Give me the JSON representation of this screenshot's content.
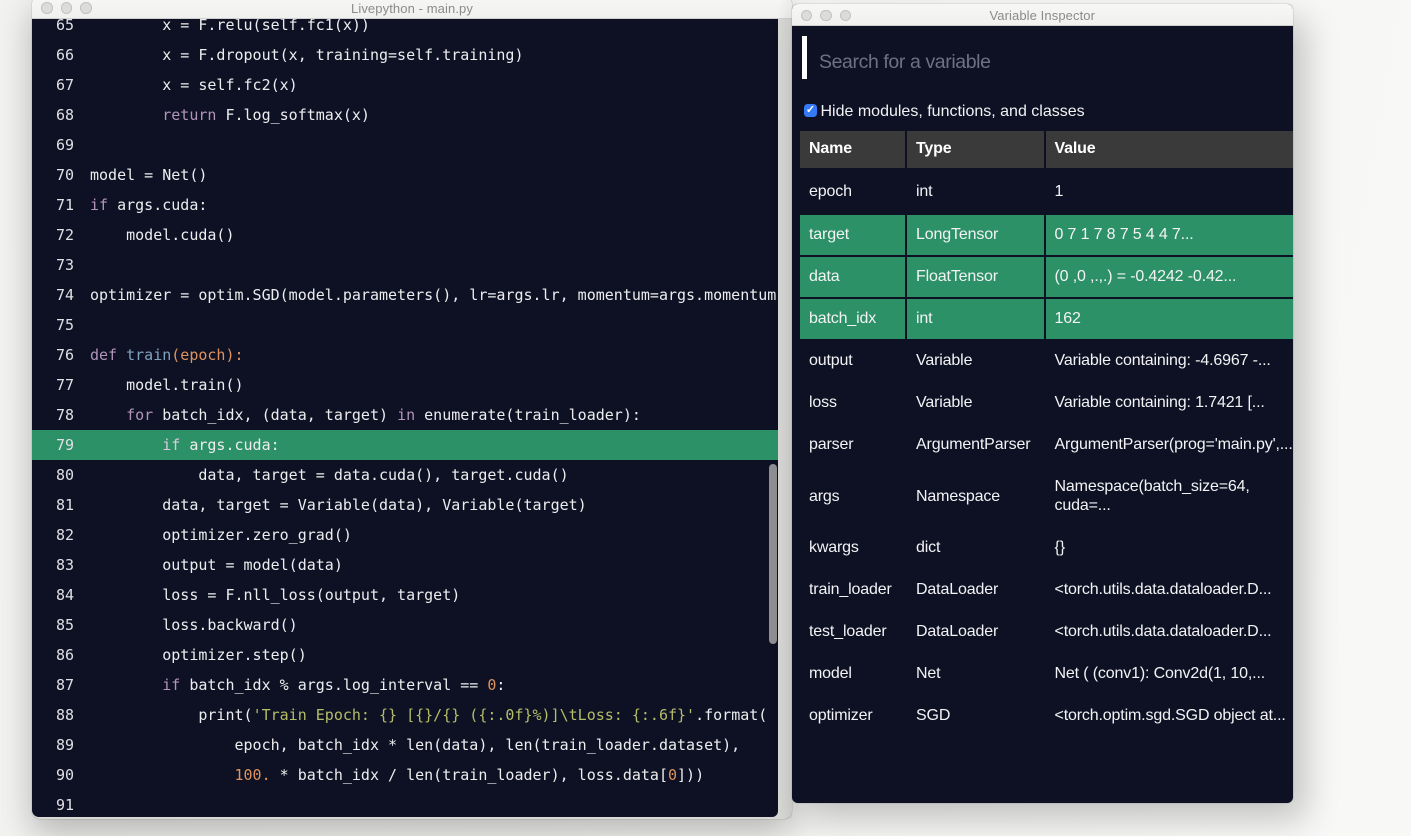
{
  "desktop": {
    "background": "#f5f5f3"
  },
  "editor_window": {
    "title": "Livepython - main.py",
    "window_buttons": [
      "close",
      "minimize",
      "zoom"
    ],
    "theme": {
      "background": "#0d1123",
      "text": "#ededef",
      "line_number": "#e0e0e6",
      "keyword": "#b294bb",
      "function_name": "#81a2be",
      "number": "#de935f",
      "string": "#b5bd68",
      "highlight_line_background": "#2d9167"
    },
    "highlighted_line": 79,
    "lines": [
      {
        "num": 65,
        "tokens": [
          [
            "        x = F.relu(self.fc1(x))",
            "default"
          ]
        ]
      },
      {
        "num": 66,
        "tokens": [
          [
            "        x = F.dropout(x, training=self.training)",
            "default"
          ]
        ]
      },
      {
        "num": 67,
        "tokens": [
          [
            "        x = self.fc2(x)",
            "default"
          ]
        ]
      },
      {
        "num": 68,
        "tokens": [
          [
            "        ",
            "default"
          ],
          [
            "return",
            "keyword"
          ],
          [
            " F.log_softmax(x)",
            "default"
          ]
        ]
      },
      {
        "num": 69,
        "tokens": []
      },
      {
        "num": 70,
        "tokens": [
          [
            "model = Net()",
            "default"
          ]
        ]
      },
      {
        "num": 71,
        "tokens": [
          [
            "if",
            "keyword"
          ],
          [
            " args.cuda:",
            "default"
          ]
        ]
      },
      {
        "num": 72,
        "tokens": [
          [
            "    model.cuda()",
            "default"
          ]
        ]
      },
      {
        "num": 73,
        "tokens": []
      },
      {
        "num": 74,
        "tokens": [
          [
            "optimizer = optim.SGD(model.parameters(), lr=args.lr, momentum=args.momentum)",
            "default"
          ]
        ]
      },
      {
        "num": 75,
        "tokens": []
      },
      {
        "num": 76,
        "tokens": [
          [
            "def",
            "keyword"
          ],
          [
            " ",
            "default"
          ],
          [
            "train",
            "function"
          ],
          [
            "(epoch):",
            "parameter"
          ]
        ]
      },
      {
        "num": 77,
        "tokens": [
          [
            "    model.train()",
            "default"
          ]
        ]
      },
      {
        "num": 78,
        "tokens": [
          [
            "    ",
            "default"
          ],
          [
            "for",
            "keyword"
          ],
          [
            " batch_idx, (data, target) ",
            "default"
          ],
          [
            "in",
            "keyword"
          ],
          [
            " enumerate(train_loader):",
            "default"
          ]
        ]
      },
      {
        "num": 79,
        "tokens": [
          [
            "        ",
            "default"
          ],
          [
            "if",
            "keyword-light"
          ],
          [
            " args.cuda:",
            "default"
          ]
        ]
      },
      {
        "num": 80,
        "tokens": [
          [
            "            data, target = data.cuda(), target.cuda()",
            "default"
          ]
        ]
      },
      {
        "num": 81,
        "tokens": [
          [
            "        data, target = Variable(data), Variable(target)",
            "default"
          ]
        ]
      },
      {
        "num": 82,
        "tokens": [
          [
            "        optimizer.zero_grad()",
            "default"
          ]
        ]
      },
      {
        "num": 83,
        "tokens": [
          [
            "        output = model(data)",
            "default"
          ]
        ]
      },
      {
        "num": 84,
        "tokens": [
          [
            "        loss = F.nll_loss(output, target)",
            "default"
          ]
        ]
      },
      {
        "num": 85,
        "tokens": [
          [
            "        loss.backward()",
            "default"
          ]
        ]
      },
      {
        "num": 86,
        "tokens": [
          [
            "        optimizer.step()",
            "default"
          ]
        ]
      },
      {
        "num": 87,
        "tokens": [
          [
            "        ",
            "default"
          ],
          [
            "if",
            "keyword"
          ],
          [
            " batch_idx % args.log_interval == ",
            "default"
          ],
          [
            "0",
            "number"
          ],
          [
            ":",
            "default"
          ]
        ]
      },
      {
        "num": 88,
        "tokens": [
          [
            "            print(",
            "default"
          ],
          [
            "'Train Epoch: {} [{}/{} ({:.0f}%)]\\tLoss: {:.6f}'",
            "string"
          ],
          [
            ".format(",
            "default"
          ]
        ]
      },
      {
        "num": 89,
        "tokens": [
          [
            "                epoch, batch_idx * len(data), len(train_loader.dataset),",
            "default"
          ]
        ]
      },
      {
        "num": 90,
        "tokens": [
          [
            "                ",
            "default"
          ],
          [
            "100.",
            "number"
          ],
          [
            " * batch_idx / len(train_loader), loss.data[",
            "default"
          ],
          [
            "0",
            "number"
          ],
          [
            "]))",
            "default"
          ]
        ]
      },
      {
        "num": 91,
        "tokens": []
      }
    ]
  },
  "inspector_window": {
    "title": "Variable Inspector",
    "window_buttons": [
      "close",
      "minimize",
      "zoom"
    ],
    "search": {
      "placeholder": "Search for a variable",
      "value": ""
    },
    "filter": {
      "checked": true,
      "label": "Hide modules, functions, and classes",
      "checkbox_color": "#3579f6"
    },
    "table": {
      "columns": [
        "Name",
        "Type",
        "Value"
      ],
      "header_background": "#3a3a3a",
      "highlight_color": "#2d9167",
      "rows": [
        {
          "name": "epoch",
          "type": "int",
          "value": "1",
          "highlighted": false
        },
        {
          "name": "target",
          "type": "LongTensor",
          "value": "0 7 1 7 8 7 5 4 4 7...",
          "highlighted": true
        },
        {
          "name": "data",
          "type": "FloatTensor",
          "value": "(0 ,0 ,.,.) = -0.4242 -0.42...",
          "highlighted": true
        },
        {
          "name": "batch_idx",
          "type": "int",
          "value": "162",
          "highlighted": true
        },
        {
          "name": "output",
          "type": "Variable",
          "value": "Variable containing: -4.6967 -...",
          "highlighted": false
        },
        {
          "name": "loss",
          "type": "Variable",
          "value": "Variable containing: 1.7421 [...",
          "highlighted": false
        },
        {
          "name": "parser",
          "type": "ArgumentParser",
          "value": "ArgumentParser(prog='main.py',...",
          "highlighted": false
        },
        {
          "name": "args",
          "type": "Namespace",
          "value": "Namespace(batch_size=64, cuda=...",
          "highlighted": false
        },
        {
          "name": "kwargs",
          "type": "dict",
          "value": "{}",
          "highlighted": false
        },
        {
          "name": "train_loader",
          "type": "DataLoader",
          "value": "<torch.utils.data.dataloader.D...",
          "highlighted": false
        },
        {
          "name": "test_loader",
          "type": "DataLoader",
          "value": "<torch.utils.data.dataloader.D...",
          "highlighted": false
        },
        {
          "name": "model",
          "type": "Net",
          "value": "Net ( (conv1): Conv2d(1, 10,...",
          "highlighted": false
        },
        {
          "name": "optimizer",
          "type": "SGD",
          "value": "<torch.optim.sgd.SGD object at...",
          "highlighted": false
        }
      ]
    }
  }
}
